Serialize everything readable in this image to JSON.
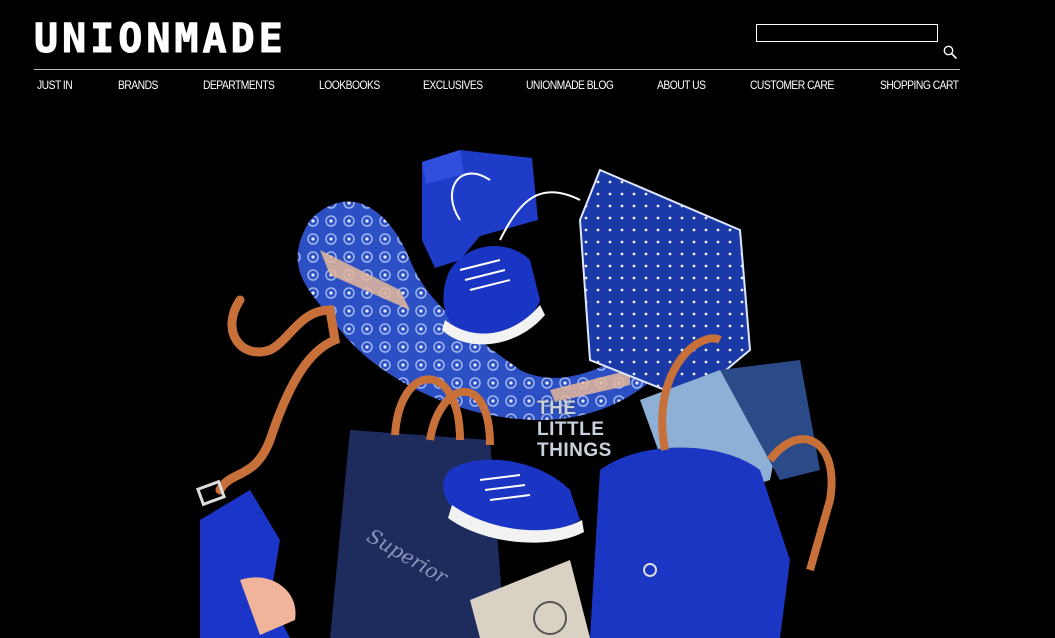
{
  "header": {
    "logo_text": "UNIONMADE",
    "search": {
      "value": "",
      "placeholder": ""
    }
  },
  "nav": {
    "items": [
      {
        "label": "JUST IN"
      },
      {
        "label": "BRANDS"
      },
      {
        "label": "DEPARTMENTS"
      },
      {
        "label": "LOOKBOOKS"
      },
      {
        "label": "EXCLUSIVES"
      },
      {
        "label": "UNIONMADE BLOG"
      },
      {
        "label": "ABOUT US"
      },
      {
        "label": "CUSTOMER CARE"
      },
      {
        "label": "SHOPPING CART"
      }
    ]
  },
  "hero": {
    "title": "THE\nLITTLE\nTHINGS"
  },
  "colors": {
    "background": "#000000",
    "text": "#ffffff",
    "accent_blue": "#1f3fbf",
    "leather_tan": "#c8703a"
  }
}
